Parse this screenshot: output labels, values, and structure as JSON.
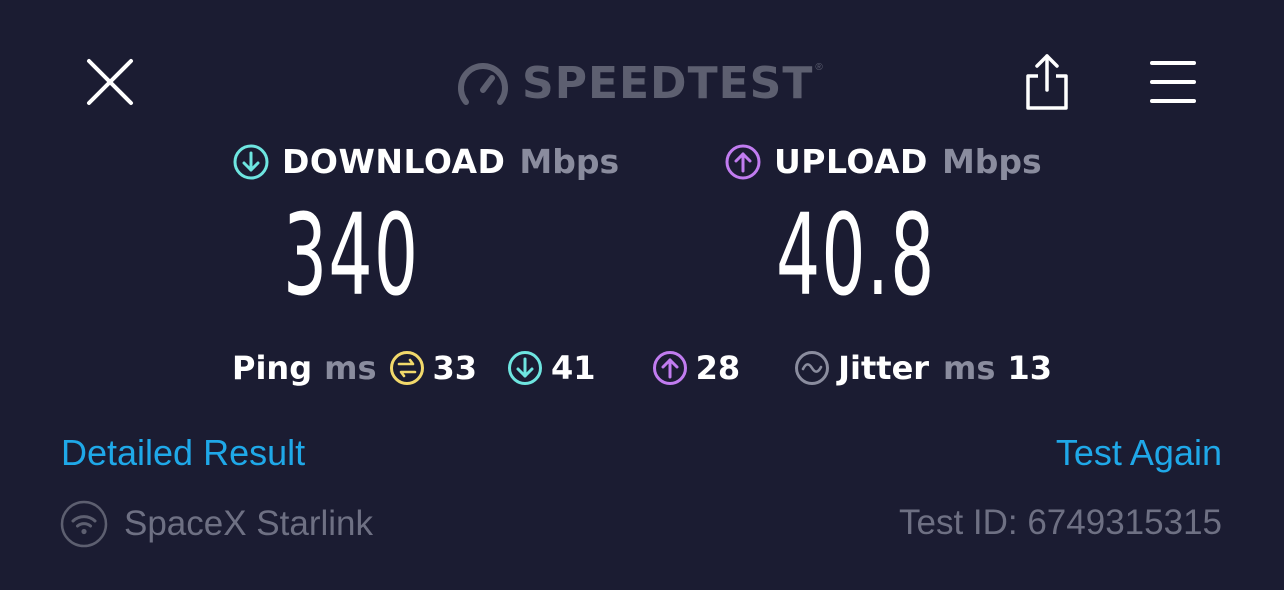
{
  "header": {
    "logo_text": "SPEEDTEST",
    "logo_mark": "®",
    "icons": [
      "close-icon",
      "speedometer-icon",
      "share-icon",
      "menu-icon"
    ]
  },
  "download": {
    "label": "DOWNLOAD",
    "unit": "Mbps",
    "value": "340",
    "icon": "arrow-down-circle-icon",
    "accent": "#6ee5e0"
  },
  "upload": {
    "label": "UPLOAD",
    "unit": "Mbps",
    "value": "40.8",
    "icon": "arrow-up-circle-icon",
    "accent": "#c17cf0"
  },
  "ping": {
    "label": "Ping",
    "unit": "ms",
    "idle": "33",
    "download": "41",
    "upload": "28",
    "idle_accent": "#f2d96b"
  },
  "jitter": {
    "label": "Jitter",
    "unit": "ms",
    "value": "13"
  },
  "links": {
    "detailed": "Detailed Result",
    "again": "Test Again",
    "color": "#1fa8e8"
  },
  "footer": {
    "provider": "SpaceX Starlink",
    "test_id": "Test ID: 6749315315"
  }
}
